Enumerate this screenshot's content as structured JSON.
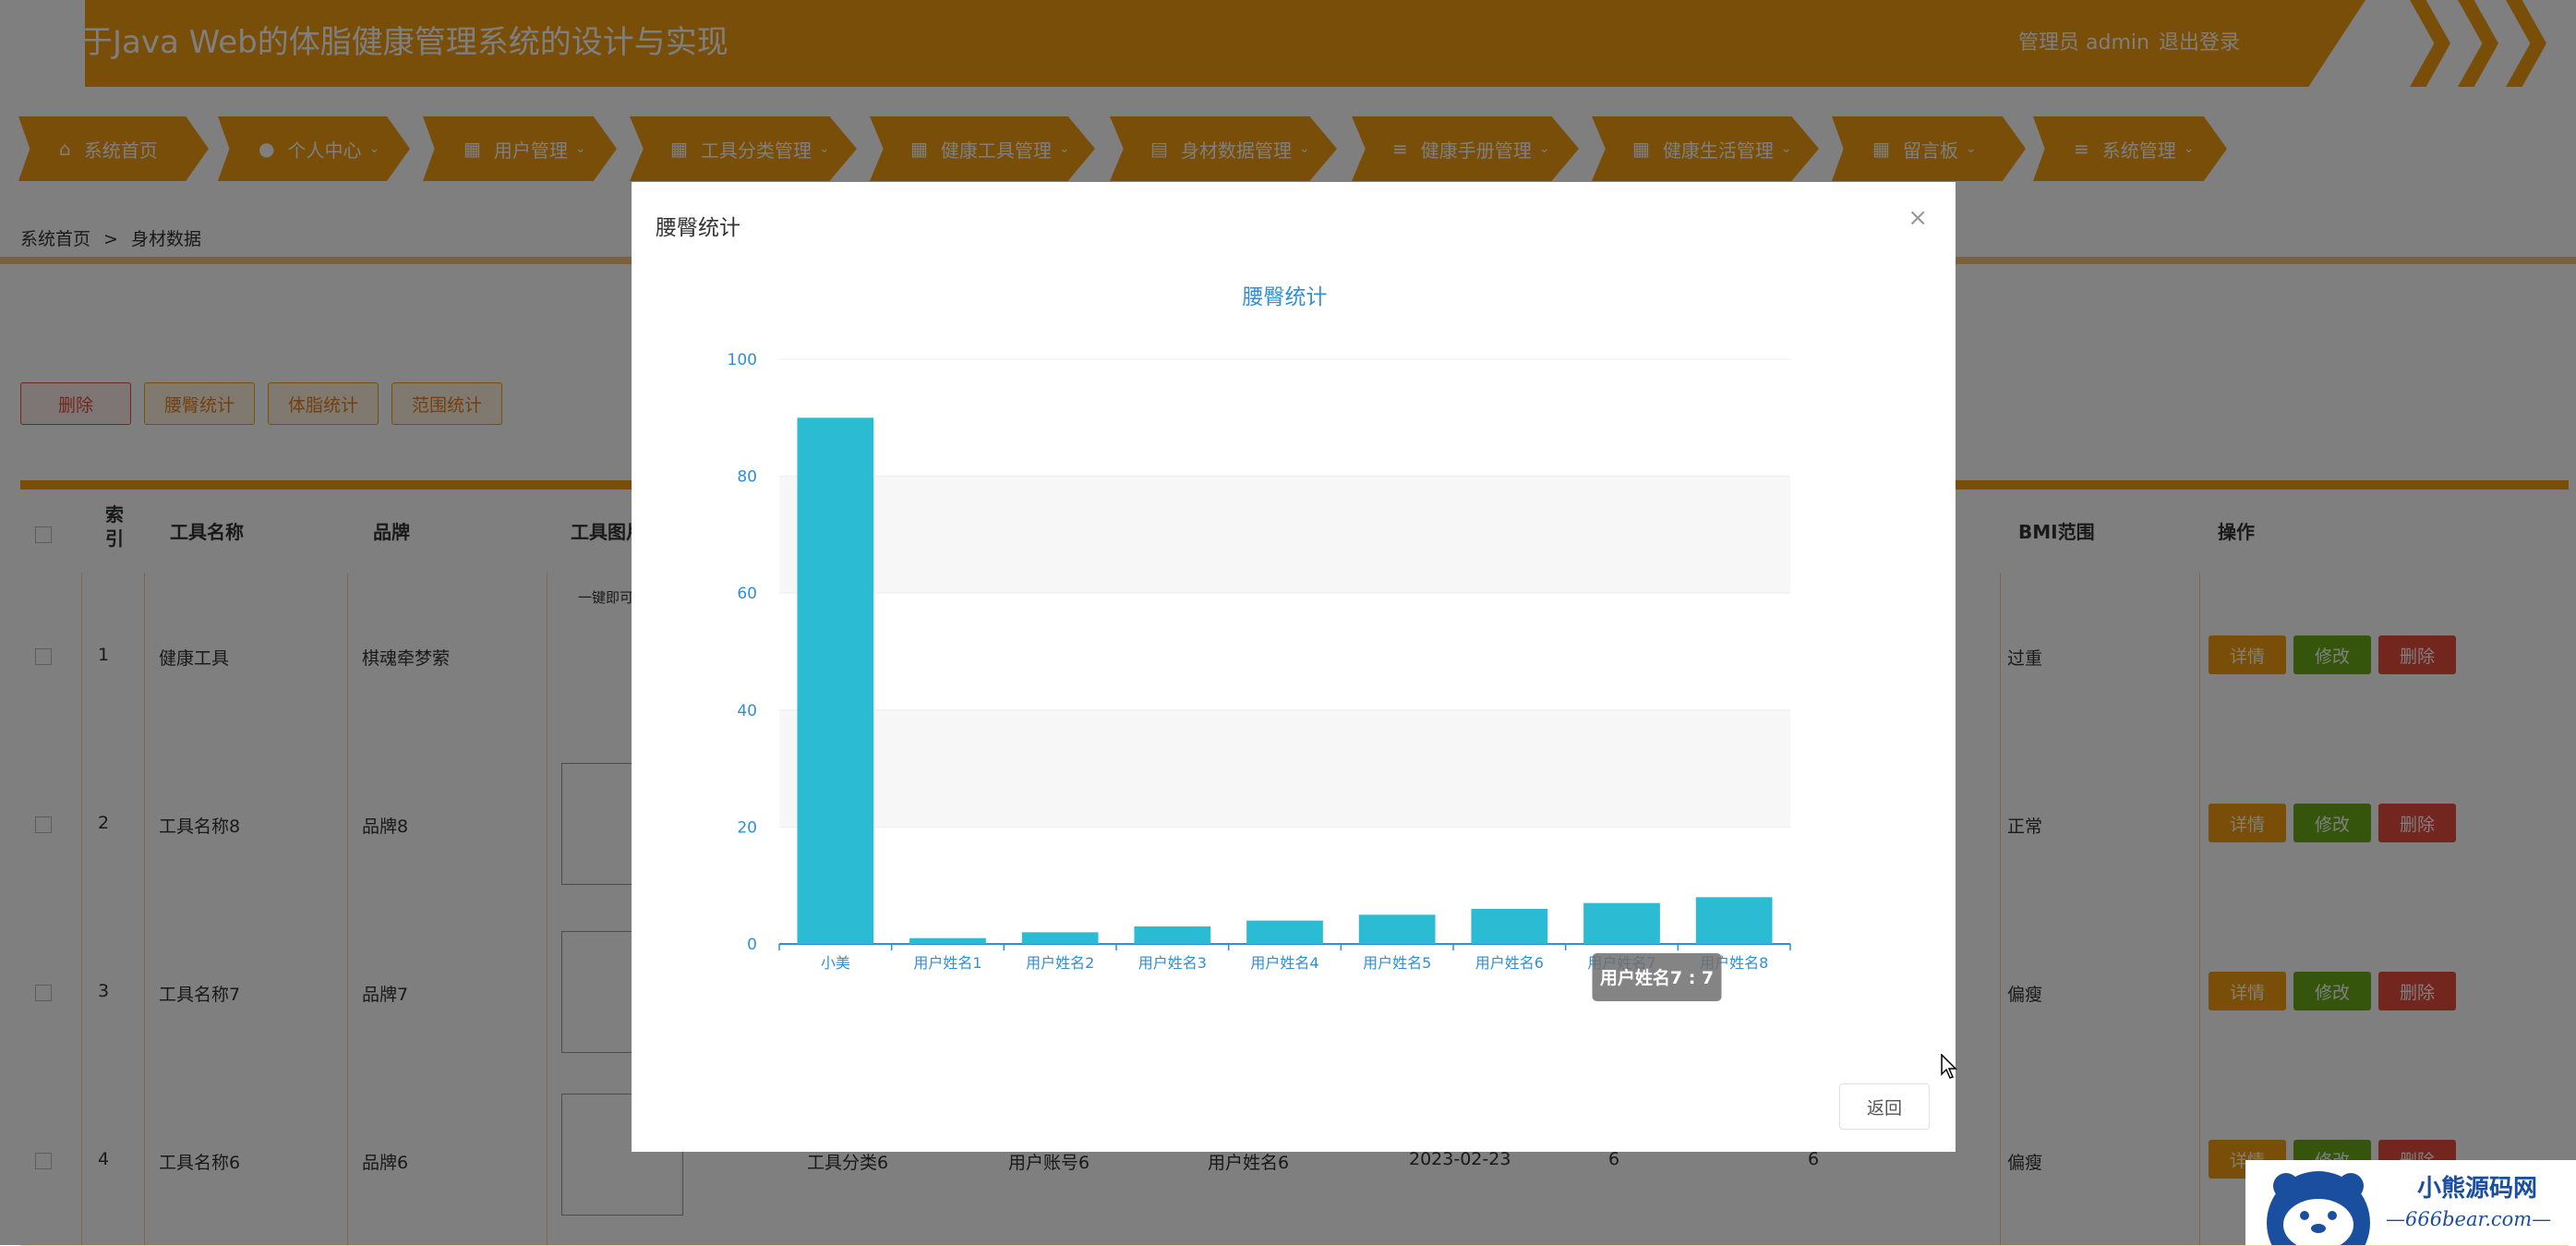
{
  "header": {
    "title": "于Java Web的体脂健康管理系统的设计与实现",
    "user_label": "管理员 admin",
    "logout_label": "退出登录"
  },
  "nav": {
    "items": [
      {
        "label": "系统首页",
        "icon": "home-icon"
      },
      {
        "label": "个人中心",
        "icon": "user-icon"
      },
      {
        "label": "用户管理",
        "icon": "grid-icon"
      },
      {
        "label": "工具分类管理",
        "icon": "grid-icon"
      },
      {
        "label": "健康工具管理",
        "icon": "grid-icon"
      },
      {
        "label": "身材数据管理",
        "icon": "table-icon"
      },
      {
        "label": "健康手册管理",
        "icon": "list-icon"
      },
      {
        "label": "健康生活管理",
        "icon": "grid-icon"
      },
      {
        "label": "留言板",
        "icon": "grid-icon"
      },
      {
        "label": "系统管理",
        "icon": "list-icon"
      }
    ]
  },
  "breadcrumb": {
    "home": "系统首页",
    "sep": ">",
    "current": "身材数据"
  },
  "actions": {
    "delete": "删除",
    "waist_stats": "腰臀统计",
    "bodyfat_stats": "体脂统计",
    "range_stats": "范围统计"
  },
  "table": {
    "headers": {
      "index": "索引",
      "tool_name": "工具名称",
      "brand": "品牌",
      "tool_image": "工具图片",
      "bmi_range": "BMI范围",
      "operation": "操作"
    },
    "rows": [
      {
        "index": "1",
        "tool_name": "健康工具",
        "brand": "棋魂牵梦萦",
        "bmi": "过重",
        "image_text": "一键即可"
      },
      {
        "index": "2",
        "tool_name": "工具名称8",
        "brand": "品牌8",
        "bmi": "正常"
      },
      {
        "index": "3",
        "tool_name": "工具名称7",
        "brand": "品牌7",
        "bmi": "偏瘦"
      },
      {
        "index": "4",
        "tool_name": "工具名称6",
        "brand": "品牌6",
        "bmi": "偏瘦",
        "category": "工具分类6",
        "account": "用户账号6",
        "username": "用户姓名6",
        "date": "2023-02-23",
        "v1": "6",
        "v2": "6"
      }
    ],
    "btn_detail": "详情",
    "btn_edit": "修改",
    "btn_delete": "删除"
  },
  "modal": {
    "title": "腰臀统计",
    "back_label": "返回",
    "tooltip": "用户姓名7 : 7"
  },
  "chart_data": {
    "type": "bar",
    "title": "腰臀统计",
    "categories": [
      "小美",
      "用户姓名1",
      "用户姓名2",
      "用户姓名3",
      "用户姓名4",
      "用户姓名5",
      "用户姓名6",
      "用户姓名7",
      "用户姓名8"
    ],
    "values": [
      90,
      1,
      2,
      3,
      4,
      5,
      6,
      7,
      8
    ],
    "ylim": [
      0,
      100
    ],
    "yticks": [
      0,
      20,
      40,
      60,
      80,
      100
    ],
    "xlabel": "",
    "ylabel": "",
    "bar_color": "#2bbcd4",
    "grid": true
  },
  "colors": {
    "accent": "#f39c12",
    "bar": "#2bbcd4",
    "title_blue": "#2f8fd8"
  },
  "watermark": {
    "line1": "小熊源码网",
    "line2": "—666bear.com—"
  }
}
